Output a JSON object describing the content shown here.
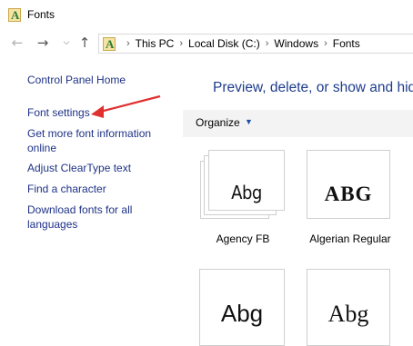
{
  "window": {
    "title": "Fonts"
  },
  "navigation": {
    "back_icon": "arrow-left-icon",
    "forward_icon": "arrow-right-icon",
    "recent_icon": "chevron-down-icon",
    "up_icon": "arrow-up-icon"
  },
  "address": {
    "crumbs": [
      "This PC",
      "Local Disk (C:)",
      "Windows",
      "Fonts"
    ]
  },
  "sidebar": {
    "items": [
      {
        "label": "Control Panel Home"
      },
      {
        "label": "Font settings"
      },
      {
        "label": "Get more font information\nonline"
      },
      {
        "label": "Adjust ClearType text"
      },
      {
        "label": "Find a character"
      },
      {
        "label": "Download fonts for all\nlanguages"
      }
    ]
  },
  "main": {
    "heading": "Preview, delete, or show and hid",
    "organize_label": "Organize",
    "fonts": [
      {
        "name": "Agency FB",
        "preview": "Abg"
      },
      {
        "name": "Algerian Regular",
        "preview": "ABG"
      },
      {
        "name": "",
        "preview": "Abg"
      },
      {
        "name": "",
        "preview": "Abg"
      }
    ]
  },
  "colors": {
    "link": "#1e3287",
    "heading": "#1e3c8c",
    "arrow": "#e03030",
    "toolbar_bg": "#f3f3f3"
  }
}
